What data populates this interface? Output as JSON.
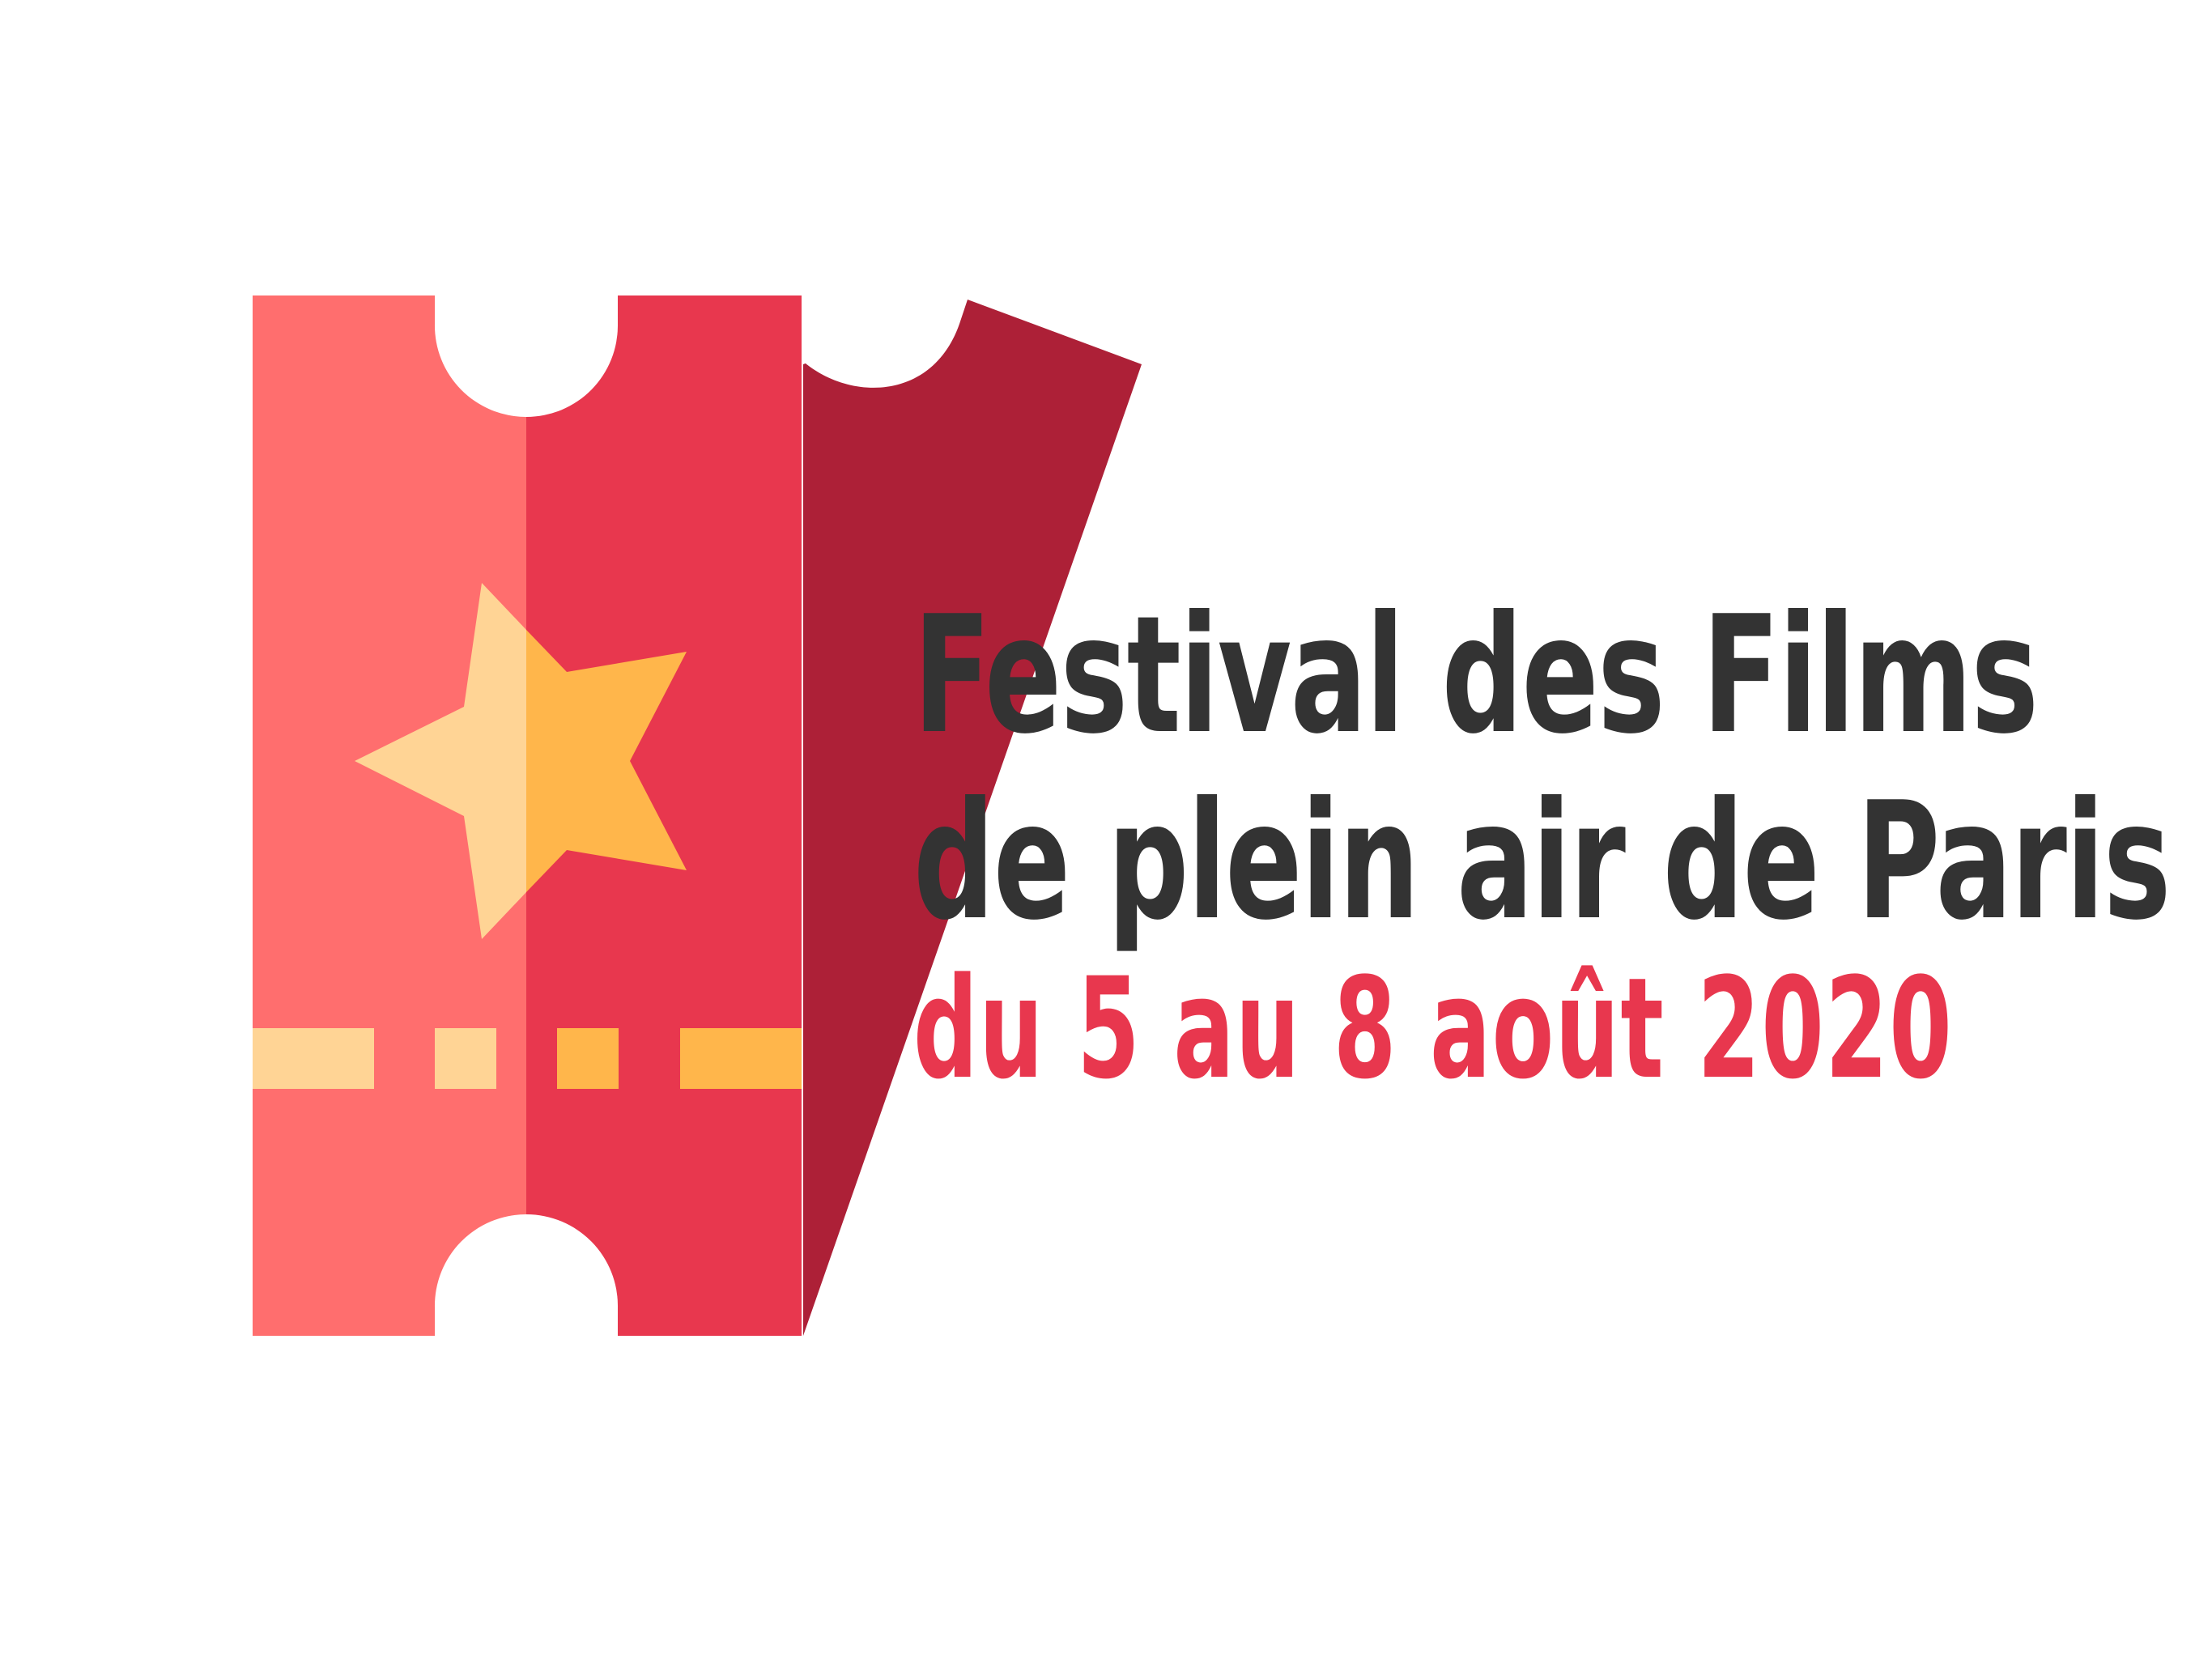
{
  "title": {
    "line1": "Festival des Films",
    "line2": "de plein air de Paris"
  },
  "dates": "du 5 au 8 août 2020",
  "colors": {
    "background": "#ffffff",
    "ticket_light": "#ff6e6e",
    "ticket_mid": "#e8374e",
    "ticket_dark": "#ad2037",
    "star_light": "#ffd495",
    "star_dark": "#ffb64b",
    "title_text": "#333333",
    "date_text": "#e8374e"
  },
  "icons": {
    "logo": "cinema-ticket-icon",
    "star": "star-icon"
  }
}
